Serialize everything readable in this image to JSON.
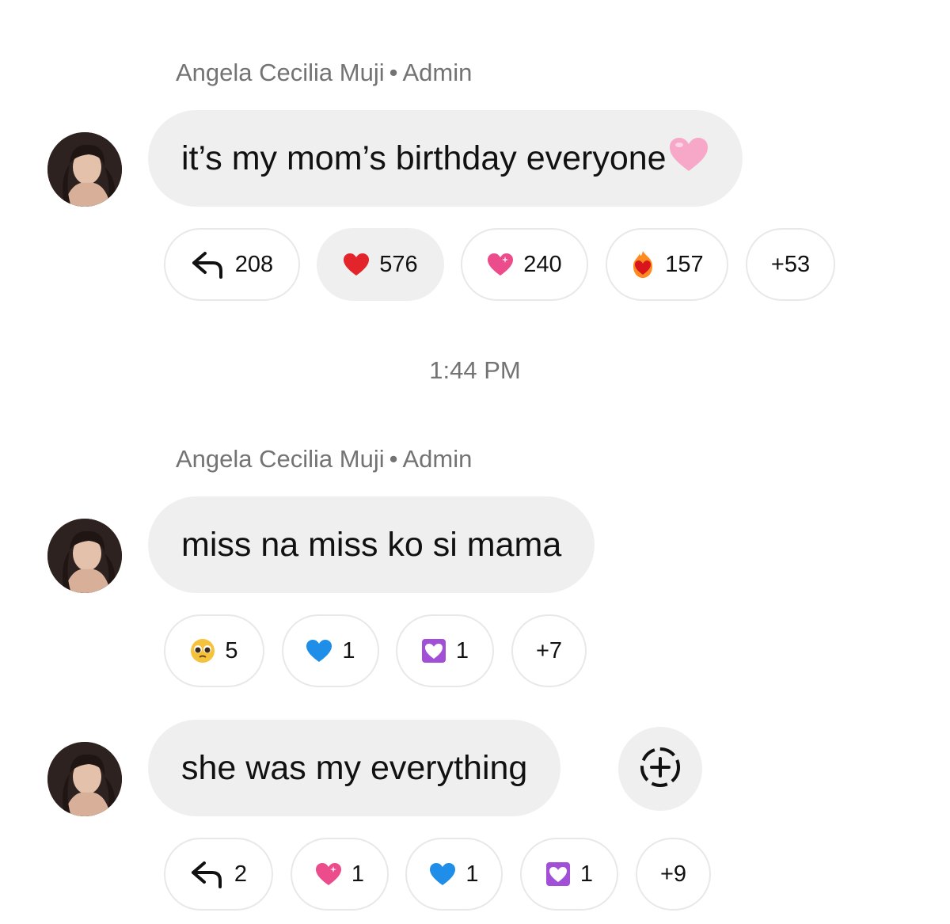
{
  "messages": [
    {
      "sender": "Angela Cecilia Muji",
      "role": "Admin",
      "text": "it’s my mom’s birthday everyone",
      "text_emoji": "pink-heart",
      "reactions": [
        {
          "icon": "reply-icon",
          "count": "208"
        },
        {
          "icon": "red-heart-icon",
          "count": "576",
          "active": true
        },
        {
          "icon": "sparkling-heart-icon",
          "count": "240"
        },
        {
          "icon": "heart-on-fire-icon",
          "count": "157"
        },
        {
          "label": "+53"
        }
      ]
    },
    {
      "sender": "Angela Cecilia Muji",
      "role": "Admin",
      "text": "miss na miss ko si mama",
      "reactions": [
        {
          "icon": "pleading-face-icon",
          "count": "5"
        },
        {
          "icon": "blue-heart-icon",
          "count": "1"
        },
        {
          "icon": "heart-decoration-icon",
          "count": "1"
        },
        {
          "label": "+7"
        }
      ]
    },
    {
      "text": "she was my everything",
      "reactions": [
        {
          "icon": "reply-icon",
          "count": "2"
        },
        {
          "icon": "sparkling-heart-icon",
          "count": "1"
        },
        {
          "icon": "blue-heart-icon",
          "count": "1"
        },
        {
          "icon": "heart-decoration-icon",
          "count": "1"
        },
        {
          "label": "+9"
        }
      ]
    }
  ],
  "timestamp": "1:44 PM",
  "colors": {
    "bubble": "#efefef",
    "meta_text": "#737373",
    "pill_border": "#e8e8e8"
  }
}
